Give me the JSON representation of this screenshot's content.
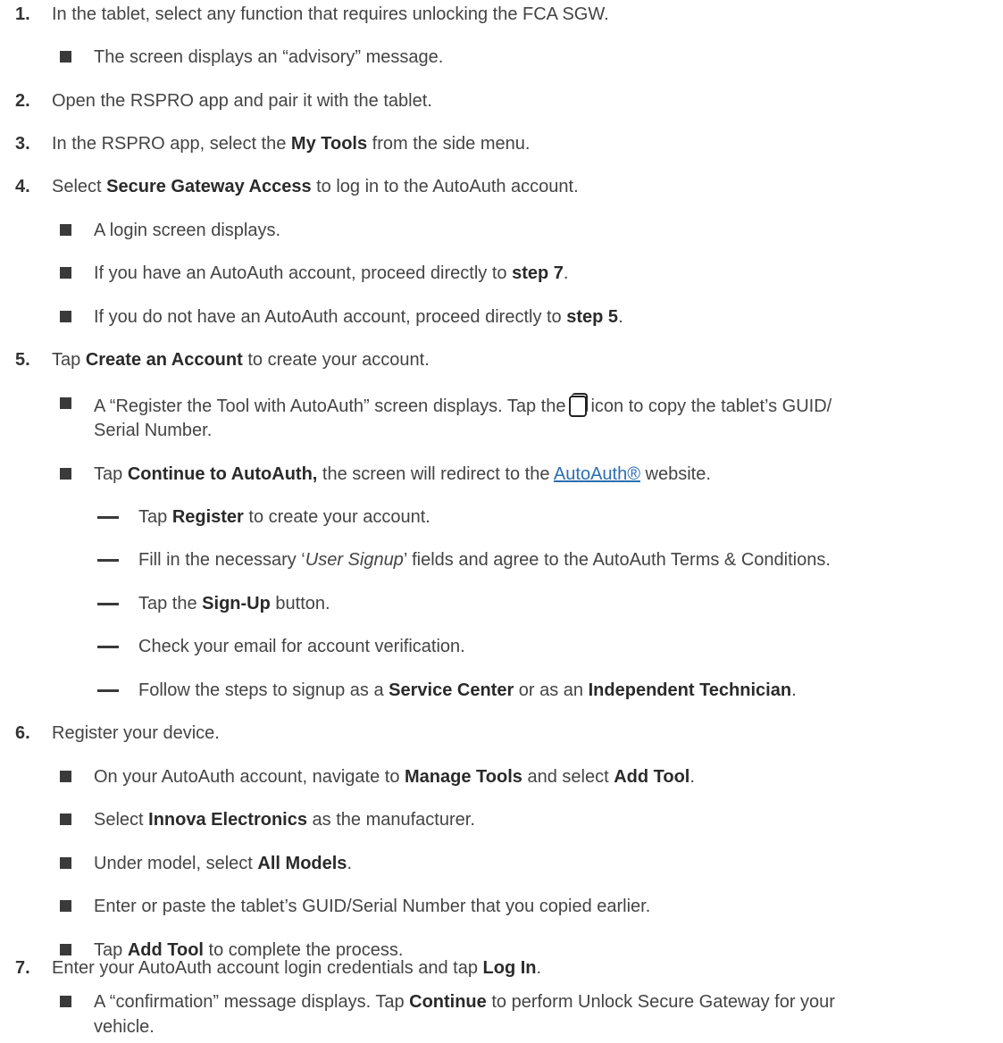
{
  "steps": [
    {
      "num": "1.",
      "text": "In the tablet, select any function that requires unlocking the FCA SGW."
    },
    {
      "sub_1_1": "The screen displays an “advisory” message."
    },
    {
      "num": "2.",
      "text": "Open the RSPRO app and pair it with the tablet."
    },
    {
      "num": "3.",
      "pre": "In the RSPRO app, select the ",
      "bold": "My Tools",
      "post": " from the side menu."
    },
    {
      "num": "4.",
      "pre": "Select ",
      "bold": "Secure Gateway Access",
      "post": " to log in to the AutoAuth account."
    },
    {
      "num": "5.",
      "pre": "Tap ",
      "bold": "Create an Account",
      "post": " to create your account."
    },
    {
      "num": "6.",
      "text": "Register your device."
    },
    {
      "num": "7.",
      "pre": "Enter your AutoAuth account login credentials and tap ",
      "bold": "Log In",
      "post": "."
    }
  ],
  "s4": {
    "a": "A login screen displays.",
    "b_pre": "If you have an AutoAuth account, proceed directly to ",
    "b_bold": "step 7",
    "b_post": ".",
    "c_pre": "If you do not have an AutoAuth account, proceed directly to ",
    "c_bold": "step 5",
    "c_post": "."
  },
  "s5": {
    "a_pre": "A “Register the Tool with AutoAuth” screen displays. Tap the",
    "a_post": "icon to copy the tablet’s GUID/",
    "a_line2": "Serial Number.",
    "copy_icon": "copy-icon",
    "b_pre": "Tap ",
    "b_bold": "Continue to AutoAuth,",
    "b_mid": " the screen will redirect to the ",
    "b_link": "AutoAuth®",
    "b_post": " website.",
    "d1_pre": "Tap ",
    "d1_bold": "Register",
    "d1_post": " to create your account.",
    "d2_pre": "Fill in the necessary ‘",
    "d2_italic": "User Signup",
    "d2_post": "’ fields and agree to the AutoAuth Terms & Conditions.",
    "d3_pre": "Tap the ",
    "d3_bold": "Sign-Up",
    "d3_post": " button.",
    "d4": "Check your email for account verification.",
    "d5_pre": "Follow the steps to signup as a ",
    "d5_bold1": "Service Center",
    "d5_mid": " or as an ",
    "d5_bold2": "Independent Technician",
    "d5_post": "."
  },
  "s6": {
    "a_pre": "On your AutoAuth account, navigate to ",
    "a_bold1": "Manage Tools",
    "a_mid": " and select ",
    "a_bold2": "Add Tool",
    "a_post": ".",
    "b_pre": "Select ",
    "b_bold": "Innova Electronics",
    "b_post": " as the manufacturer.",
    "c_pre": "Under model, select ",
    "c_bold": "All Models",
    "c_post": ".",
    "d": "Enter or paste the tablet’s GUID/Serial Number that you copied earlier.",
    "e_pre": "Tap ",
    "e_bold": "Add Tool",
    "e_post": " to complete the process."
  },
  "s7": {
    "a_pre": "A “confirmation” message displays. Tap ",
    "a_bold": "Continue",
    "a_post": " to perform Unlock Secure Gateway for your",
    "a_line2": "vehicle."
  }
}
